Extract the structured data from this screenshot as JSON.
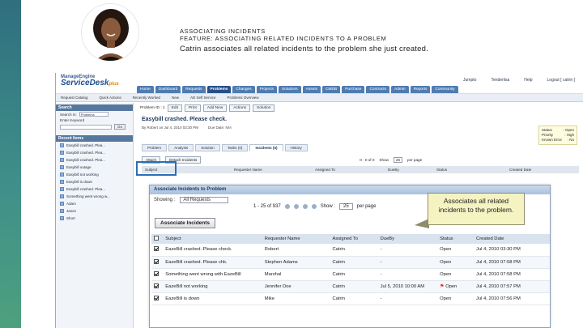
{
  "caption": {
    "line1": "ASSOCIATING INCIDENTS",
    "line2": "FEATURE: ASSOCIATING RELATED INCIDENTS TO A PROBLEM",
    "line3": "Catrin associates all related incidents to the problem she just created."
  },
  "app": {
    "brand_top": "ManageEngine",
    "brand_main": "ServiceDesk",
    "brand_plus": "plus",
    "header_links": [
      "Jumpto",
      "Tenderlisa",
      "Help",
      "Logout [ catrin ]"
    ],
    "nav_tabs": [
      "Home",
      "Dashboard",
      "Requests",
      "Problems",
      "Changes",
      "Projects",
      "Solutions",
      "Assets",
      "CMDB",
      "Purchase",
      "Contracts",
      "Admin",
      "Reports",
      "Community"
    ],
    "active_tab": "Problems",
    "toolbar_items": [
      "Request Catalog",
      "Quick Actions",
      "Recently Worked",
      "New",
      "AD Self Service",
      "Problems Overview"
    ]
  },
  "sidebar": {
    "search_header": "Search",
    "search_in_label": "Search in:",
    "search_in_value": "Problems",
    "keyword_label": "Enter Keyword",
    "go_label": "Go",
    "recent_header": "Recent Items",
    "recent_items": [
      "Easybill crashed. Plea...",
      "Easybill crashed. Plea...",
      "Easybill crashed. Plea...",
      "Easybill outage",
      "Easybill not working",
      "Easybill is down",
      "Easybill crashed. Plea...",
      "Something went wrong w...",
      "Adam",
      "Jason",
      "Short"
    ]
  },
  "problem": {
    "id_label": "Problem ID : 1",
    "buttons": [
      "Edit",
      "Print",
      "Add New",
      "Actions",
      "Solution"
    ],
    "title": "Easybill crashed. Please check.",
    "by_label": "By Robert on Jul 4, 2010 03:30 PM",
    "due_label": "Due Date: N/A",
    "status": [
      {
        "k": "Status",
        "v": ": Open"
      },
      {
        "k": "Priority",
        "v": ": High"
      },
      {
        "k": "Known Error",
        "v": ": No"
      }
    ],
    "subtabs": [
      "Problem",
      "Analysis",
      "Solution",
      "Tasks (0)",
      "Incidents (5)",
      "History"
    ],
    "active_subtab": "Incidents (5)",
    "incident_bar": [
      "Attach",
      "Detach Incidents"
    ],
    "incident_pager": "0 - 0 of 0",
    "incident_show": "Show",
    "incident_per_page": "25",
    "incident_per_page_label": "per page",
    "incident_cols": [
      "Subject",
      "Requester Name",
      "Assigned To",
      "DueBy",
      "Status",
      "Created Date"
    ]
  },
  "dialog": {
    "title": "Associate Incidents to Problem",
    "showing_label": "Showing :",
    "showing_value": "All Requests",
    "pager": "1 - 25 of 937",
    "show_label": "Show :",
    "per_page_value": "25",
    "per_page_label": "per page",
    "button": "Associate Incidents",
    "columns": [
      "",
      "Subject",
      "Requester Name",
      "Assigned To",
      "DueBy",
      "Status",
      "Created Date"
    ],
    "rows": [
      {
        "checked": true,
        "subject": "EazeBill crashed. Please check.",
        "requester": "Robert",
        "assigned": "Catrin",
        "dueby": "-",
        "flag": false,
        "status": "Open",
        "created": "Jul 4, 2010 03:30 PM"
      },
      {
        "checked": true,
        "subject": "EazeBill crashed. Please chk.",
        "requester": "Stephen Adams",
        "assigned": "Catrin",
        "dueby": "-",
        "flag": false,
        "status": "Open",
        "created": "Jul 4, 2010 07:58 PM"
      },
      {
        "checked": true,
        "subject": "Something went wrong with EazeBill",
        "requester": "Marshal",
        "assigned": "Catrin",
        "dueby": "-",
        "flag": false,
        "status": "Open",
        "created": "Jul 4, 2010 07:58 PM"
      },
      {
        "checked": true,
        "subject": "EazeBill not working",
        "requester": "Jennifer Doe",
        "assigned": "Catrin",
        "dueby": "Jul 5, 2010 10:00 AM",
        "flag": true,
        "status": "Open",
        "created": "Jul 4, 2010 07:57 PM"
      },
      {
        "checked": true,
        "subject": "EazeBill is down",
        "requester": "Mike",
        "assigned": "Catrin",
        "dueby": "-",
        "flag": false,
        "status": "Open",
        "created": "Jul 4, 2010 07:56 PM"
      }
    ]
  },
  "callout": {
    "text": "Associates all related incidents to the problem."
  },
  "colors": {
    "accent": "#27508a",
    "callout_bg": "#f6f3c2",
    "stripe": "#3f8f8a"
  }
}
